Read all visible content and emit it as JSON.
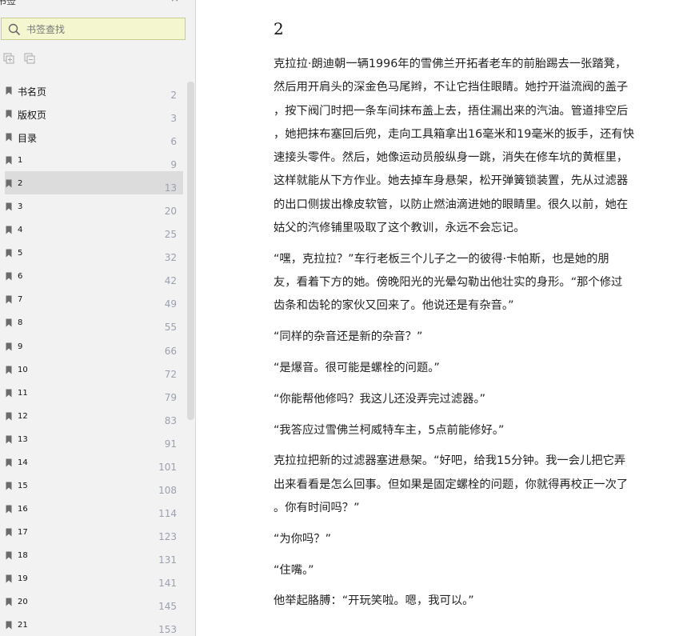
{
  "sidebar": {
    "title": "书签",
    "close_glyph": "×",
    "search_placeholder": "书签查找",
    "items": [
      {
        "label": "书名页",
        "page": "2"
      },
      {
        "label": "版权页",
        "page": "3"
      },
      {
        "label": "目录",
        "page": "6"
      },
      {
        "label": "1",
        "page": "9"
      },
      {
        "label": "2",
        "page": "13",
        "selected": true
      },
      {
        "label": "3",
        "page": "20"
      },
      {
        "label": "4",
        "page": "25"
      },
      {
        "label": "5",
        "page": "32"
      },
      {
        "label": "6",
        "page": "42"
      },
      {
        "label": "7",
        "page": "49"
      },
      {
        "label": "8",
        "page": "55"
      },
      {
        "label": "9",
        "page": "66"
      },
      {
        "label": "10",
        "page": "72"
      },
      {
        "label": "11",
        "page": "79"
      },
      {
        "label": "12",
        "page": "83"
      },
      {
        "label": "13",
        "page": "91"
      },
      {
        "label": "14",
        "page": "101"
      },
      {
        "label": "15",
        "page": "108"
      },
      {
        "label": "16",
        "page": "114"
      },
      {
        "label": "17",
        "page": "123"
      },
      {
        "label": "18",
        "page": "131"
      },
      {
        "label": "19",
        "page": "141"
      },
      {
        "label": "20",
        "page": "145"
      },
      {
        "label": "21",
        "page": "153"
      }
    ]
  },
  "content": {
    "chapter": "2",
    "paragraphs": [
      [
        "克拉拉·朗迪朝一辆1996年的雪佛兰开拓者老车的前胎踢去一张踏凳，",
        "然后用开肩头的深金色马尾辫，不让它挡住眼睛。她拧开溢流阀的盖子",
        "，按下阀门时把一条车间抹布盖上去，捂住漏出来的汽油。管道排空后",
        "，她把抹布塞回后兜，走向工具箱拿出16毫米和19毫米的扳手，还有快",
        "速接头零件。然后，她像运动员般纵身一跳，消失在修车坑的黄框里，",
        "这样就能从下方作业。她去掉车身悬架，松开弹簧锁装置，先从过滤器",
        "的出口侧拔出橡皮软管，以防止燃油滴进她的眼睛里。很久以前，她在",
        "姑父的汽修铺里吸取了这个教训，永远不会忘记。"
      ],
      [
        "“嘿，克拉拉？”车行老板三个儿子之一的彼得·卡帕斯，也是她的朋",
        "友，看着下方的她。傍晚阳光的光晕勾勒出他壮实的身形。“那个修过",
        "齿条和齿轮的家伙又回来了。他说还是有杂音。”"
      ],
      [
        "“同样的杂音还是新的杂音？”"
      ],
      [
        "“是爆音。很可能是螺栓的问题。”"
      ],
      [
        "“你能帮他修吗？我这儿还没弄完过滤器。”"
      ],
      [
        "“我答应过雪佛兰柯威特车主，5点前能修好。”"
      ],
      [
        "克拉拉把新的过滤器塞进悬架。“好吧，给我15分钟。我一会儿把它弄",
        "出来看看是怎么回事。但如果是固定螺栓的问题，你就得再校正一次了",
        "。你有时间吗？”"
      ],
      [
        "“为你吗？”"
      ],
      [
        "“住嘴。”"
      ],
      [
        "他举起胳膊：“开玩笑啦。嗯，我可以。”"
      ]
    ]
  }
}
